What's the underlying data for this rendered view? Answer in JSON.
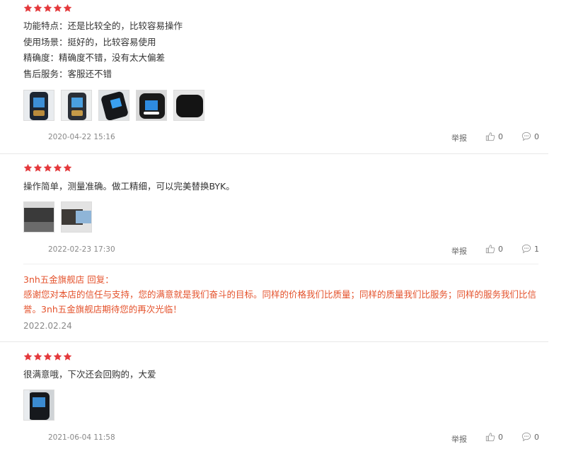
{
  "colors": {
    "star": "#e4393c",
    "reply": "#e4522c",
    "divider": "#e8e8e8",
    "muted": "#888888"
  },
  "reviews": [
    {
      "rating": 5,
      "lines": [
        "功能特点：还是比较全的，比较容易操作",
        "使用场景：挺好的，比较容易使用",
        "精确度：精确度不错，没有太大偏差",
        "售后服务：客服还不错"
      ],
      "photos": [
        "device-photo",
        "device-photo",
        "device-photo",
        "case-photo",
        "case-photo"
      ],
      "date": "2020-04-22 15:16",
      "report_label": "举报",
      "likes": "0",
      "comments": "0"
    },
    {
      "rating": 5,
      "lines": [
        "操作简单，测量准确。做工精细，可以完美替换BYK。"
      ],
      "photos": [
        "device-photo",
        "device-photo"
      ],
      "date": "2022-02-23 17:30",
      "report_label": "举报",
      "likes": "0",
      "comments": "1",
      "reply": {
        "author": "3nh五金旗舰店 回复：",
        "text": "感谢您对本店的信任与支持，您的满意就是我们奋斗的目标。同样的价格我们比质量；同样的质量我们比服务；同样的服务我们比信誉。3nh五金旗舰店期待您的再次光临！",
        "date": "2022.02.24"
      }
    },
    {
      "rating": 5,
      "lines": [
        "很满意哦，下次还会回购的，大爱"
      ],
      "photos": [
        "device-photo"
      ],
      "date": "2021-06-04 11:58",
      "report_label": "举报",
      "likes": "0",
      "comments": "0"
    }
  ]
}
